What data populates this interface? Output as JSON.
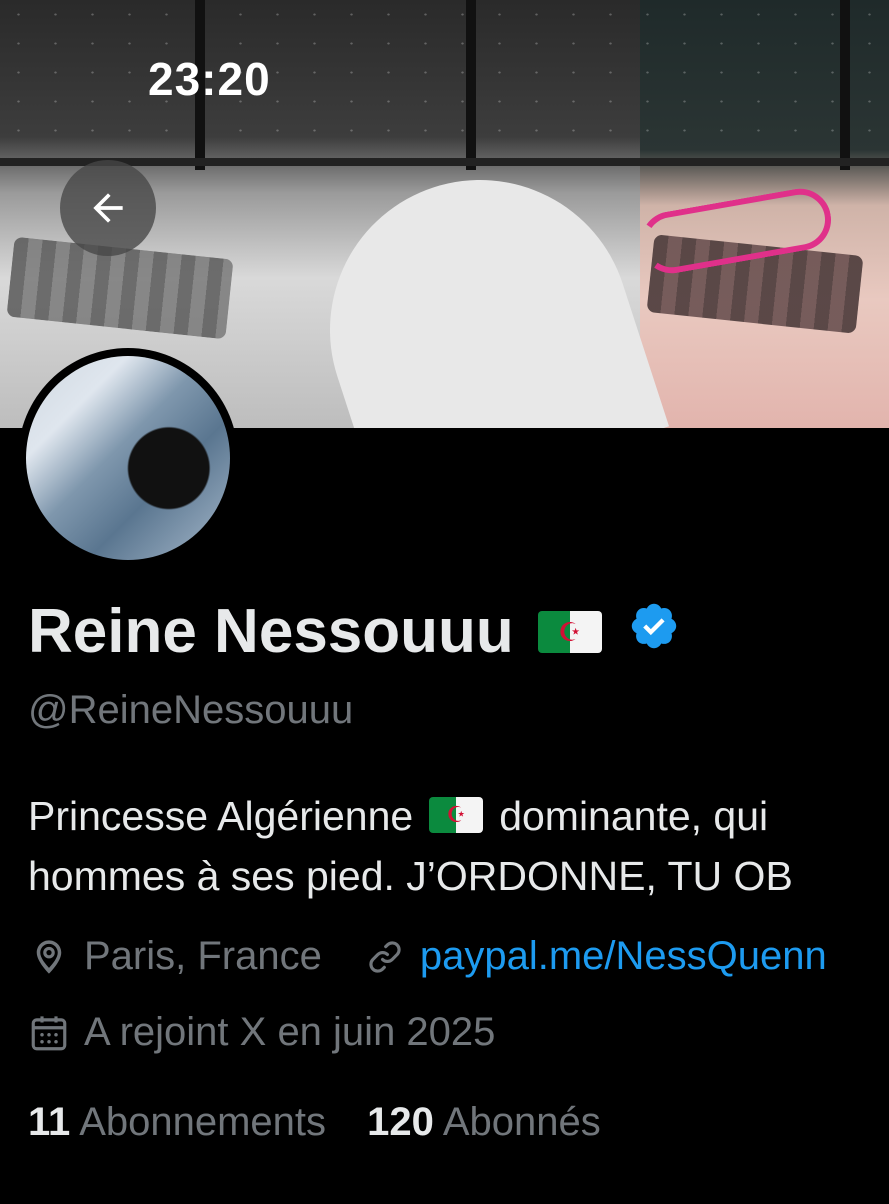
{
  "status_bar": {
    "time": "23:20"
  },
  "profile": {
    "display_name": "Reine Nessouuu",
    "flag_emoji": "🇩🇿",
    "verified": true,
    "handle": "@ReineNessouuu",
    "bio_line_1_before_flag": "Princesse Algérienne",
    "bio_line_1_after_flag": "dominante, qui",
    "bio_line_2": "hommes à ses pied. J’ORDONNE, TU OB",
    "location": "Paris, France",
    "website": "paypal.me/NessQuenn",
    "joined": "A rejoint X en juin 2025",
    "following_count": "11",
    "following_label": "Abonnements",
    "followers_count": "120",
    "followers_label": "Abonnés"
  },
  "icons": {
    "back": "arrow-left-icon",
    "verified": "verified-badge-icon",
    "location": "location-pin-icon",
    "link": "link-icon",
    "calendar": "calendar-icon"
  },
  "colors": {
    "background": "#000000",
    "primary_text": "#e7e9ea",
    "secondary_text": "#71767b",
    "link": "#1d9bf0",
    "verified": "#1d9bf0"
  }
}
